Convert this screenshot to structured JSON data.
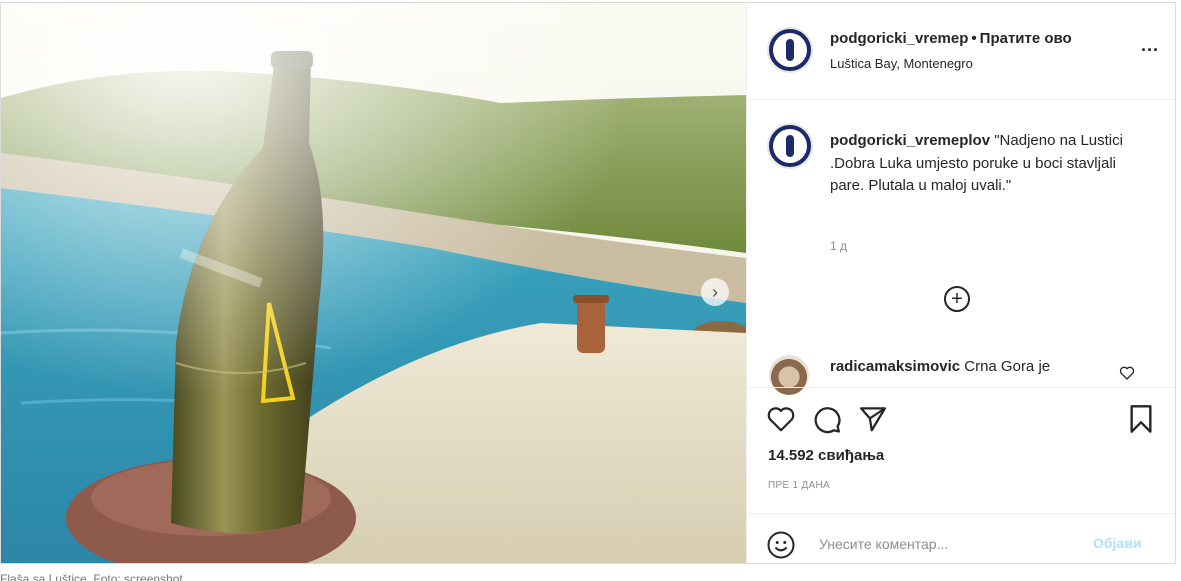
{
  "post": {
    "username": "podgoricki_vremep",
    "follow_label": "Пратите ово",
    "separator": "•",
    "location": "Luštica Bay, Montenegro",
    "more_label": "...",
    "caption_username": "podgoricki_vremeplov",
    "caption_text": "\"Nadjeno na Lustici .Dobra Luka umjesto poruke u boci stavljali pare. Plutala u maloj uvali.\"",
    "caption_time": "1 д",
    "add_label": "+",
    "comment_username": "radicamaksimovic",
    "comment_text": "Crna Gora je",
    "likes": "14.592 свиђања",
    "posted_ago": "ПРЕ 1 ДАНА",
    "comment_placeholder": "Унесите коментар...",
    "post_button": "Објави",
    "next_label": "›"
  },
  "icons": {
    "heart": "heart-icon",
    "comment": "comment-icon",
    "share": "share-icon",
    "bookmark": "bookmark-icon",
    "emoji": "emoji-icon",
    "add": "add-circle-icon"
  },
  "colors": {
    "text": "#262626",
    "muted": "#8e8e8e",
    "post_button": "#b2dffc",
    "avatar": "#1b2a6b"
  },
  "source_caption": "Flaša sa Luštice. Foto: screenshot"
}
